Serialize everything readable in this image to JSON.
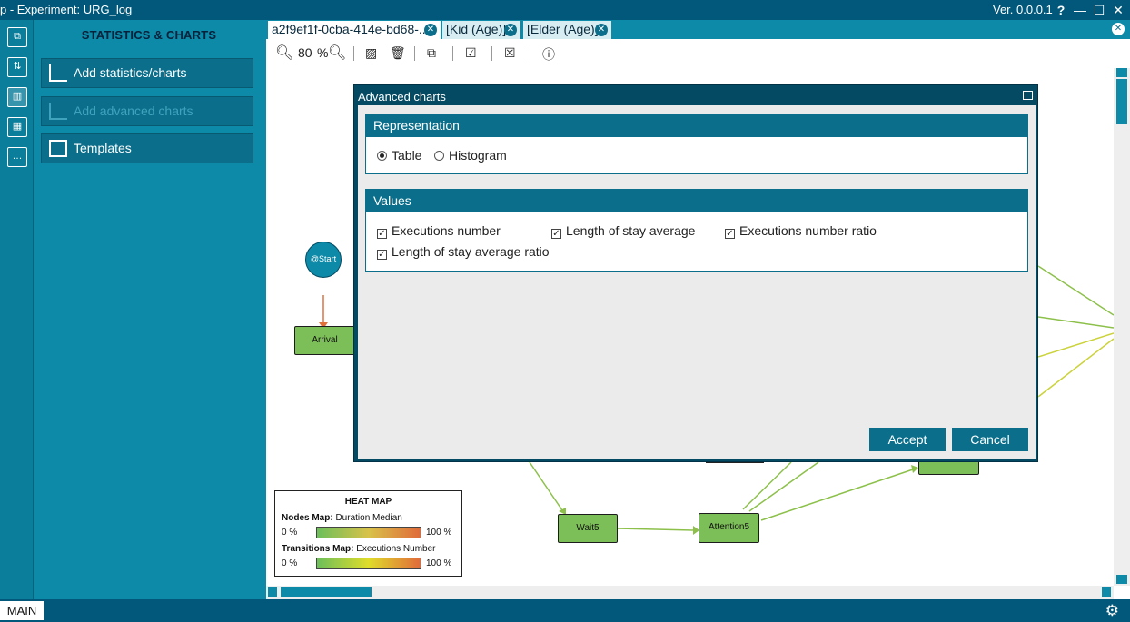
{
  "window": {
    "title": "p  -  Experiment: URG_log",
    "version": "Ver. 0.0.0.1",
    "help": "?",
    "minimize": "—",
    "maximize": "☐",
    "close": "✕"
  },
  "sidebar": {
    "header": "STATISTICS & CHARTS",
    "buttons": [
      {
        "label": "Add statistics/charts",
        "enabled": true
      },
      {
        "label": "Add advanced charts",
        "enabled": false
      },
      {
        "label": "Templates",
        "enabled": true
      }
    ]
  },
  "tabs": [
    {
      "label": "a2f9ef1f-0cba-414e-bd68-...",
      "active": true
    },
    {
      "label": "[Kid (Age)]",
      "active": false
    },
    {
      "label": "[Elder (Age)]",
      "active": false
    }
  ],
  "toolbar": {
    "zoom": "80",
    "zoom_unit": "%"
  },
  "graph": {
    "start_label": "@Start",
    "nodes": [
      "Arrival",
      "Wait5",
      "Attention5"
    ]
  },
  "heatmap": {
    "title": "HEAT MAP",
    "nodes_label": "Nodes Map:",
    "nodes_value": "Duration Median",
    "transitions_label": "Transitions Map:",
    "transitions_value": "Executions Number",
    "min": "0 %",
    "max": "100 %"
  },
  "dialog": {
    "title": "Advanced charts",
    "representation": {
      "header": "Representation",
      "options": [
        {
          "label": "Table",
          "selected": true
        },
        {
          "label": "Histogram",
          "selected": false
        }
      ]
    },
    "values": {
      "header": "Values",
      "options": [
        {
          "label": "Executions number",
          "checked": true
        },
        {
          "label": "Length of stay average",
          "checked": true
        },
        {
          "label": "Executions number ratio",
          "checked": true
        },
        {
          "label": "Length of stay average ratio",
          "checked": true
        }
      ]
    },
    "accept": "Accept",
    "cancel": "Cancel"
  },
  "statusbar": {
    "main": "MAIN"
  }
}
